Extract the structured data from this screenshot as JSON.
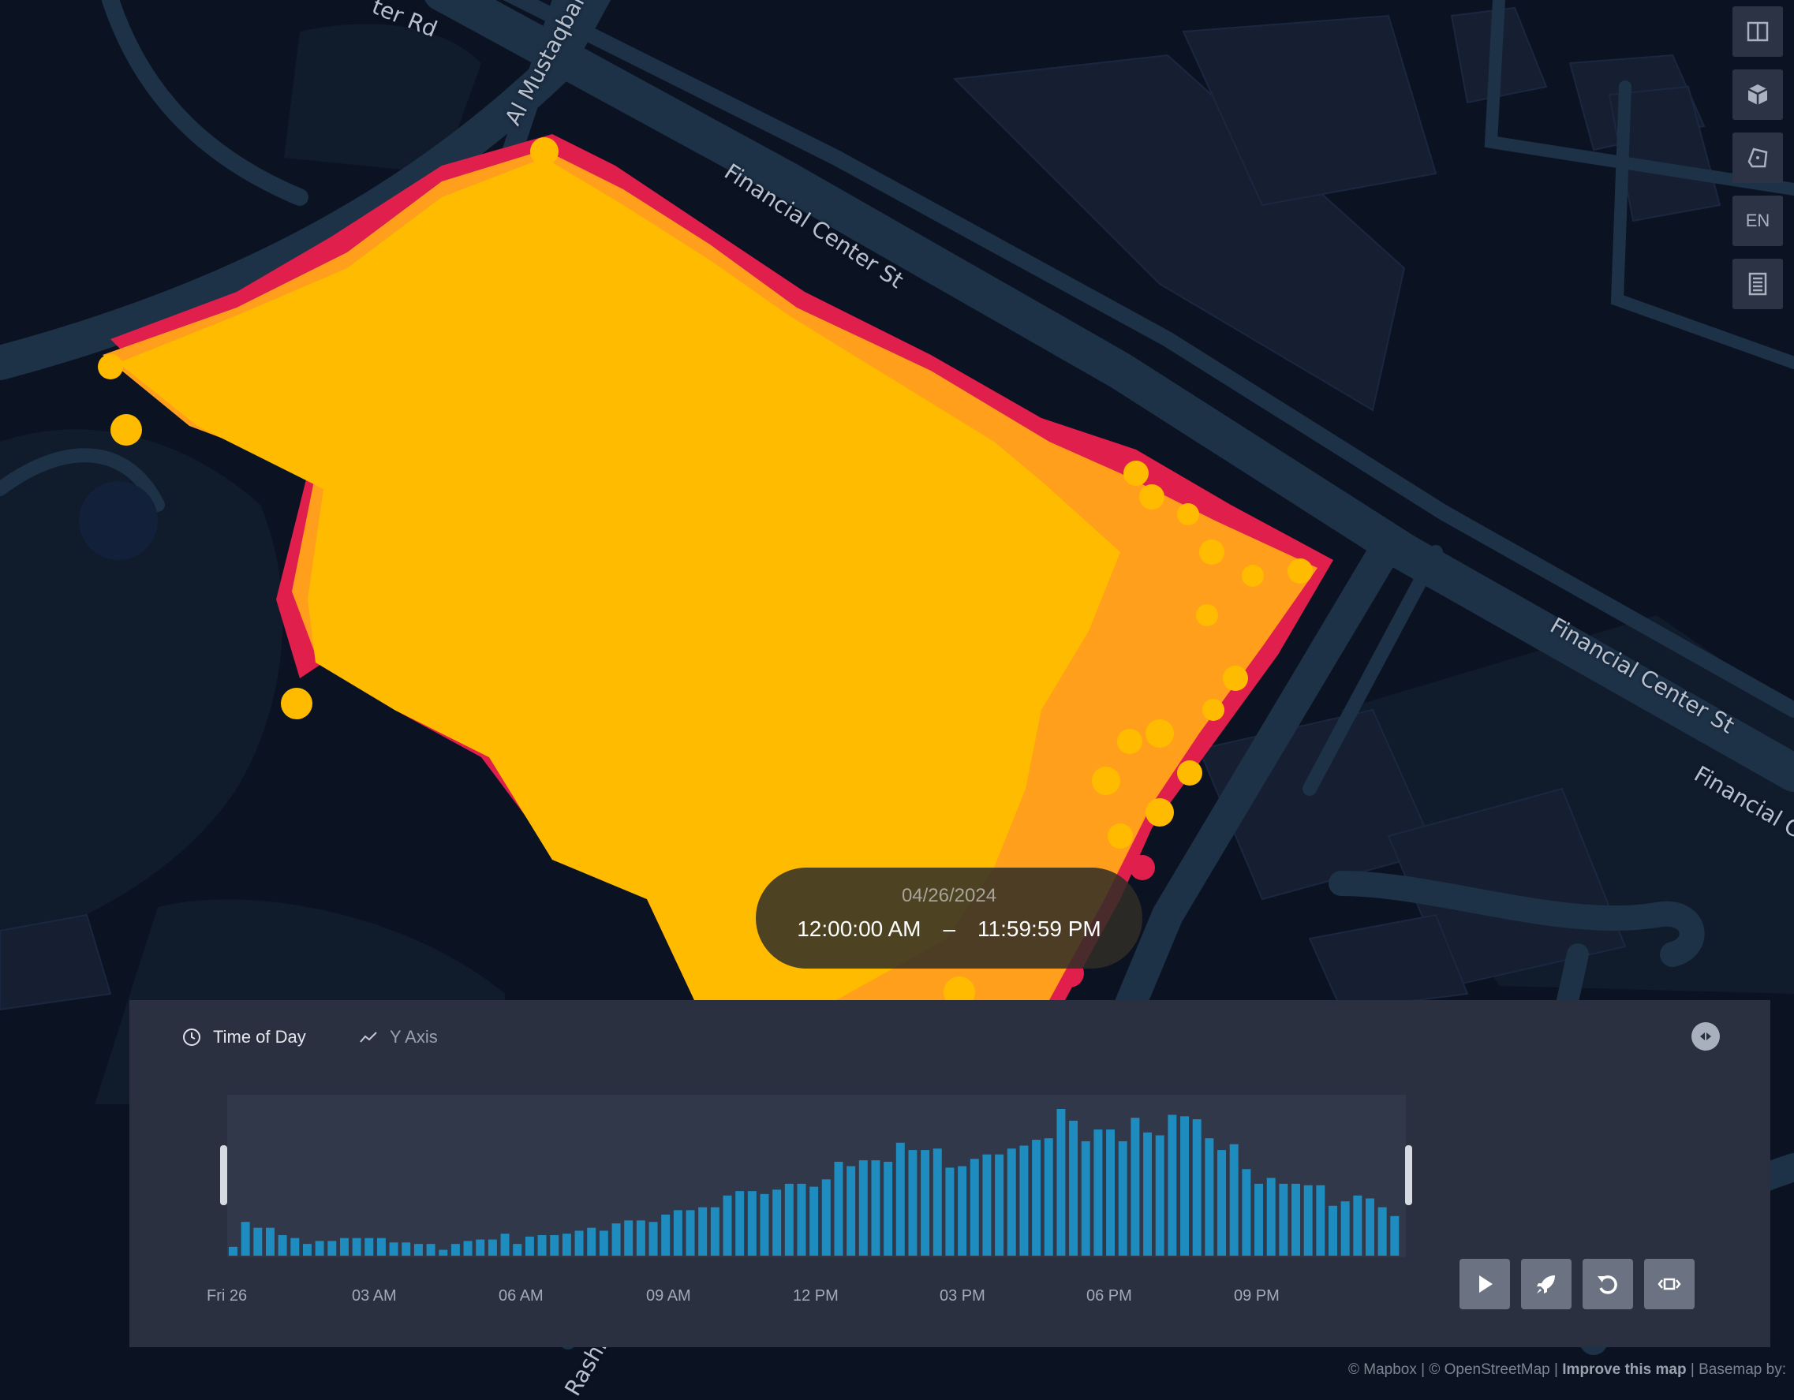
{
  "map": {
    "street_labels": [
      "ter Rd",
      "Al Mustaqbal",
      "Financial Center St",
      "Financial Center St",
      "Financial C",
      "Rashid"
    ],
    "colors": {
      "water": "#0b1222",
      "roads": "#1d3147",
      "points_main": "#ffbb00",
      "points_mid": "#ff9a1a",
      "points_edge": "#e8254a"
    }
  },
  "toolbar": {
    "buttons": [
      {
        "name": "split-map-icon"
      },
      {
        "name": "3d-cube-icon"
      },
      {
        "name": "draw-polygon-icon"
      },
      {
        "name": "language",
        "label": "EN"
      },
      {
        "name": "legend-icon"
      }
    ]
  },
  "time_bubble": {
    "date": "04/26/2024",
    "start": "12:00:00 AM",
    "separator": "–",
    "end": "11:59:59 PM"
  },
  "timeline": {
    "tabs": [
      {
        "name": "time-of-day",
        "label": "Time of Day",
        "icon": "clock-icon",
        "active": true
      },
      {
        "name": "y-axis",
        "label": "Y Axis",
        "icon": "line-chart-icon",
        "active": false
      }
    ],
    "controls": [
      "play-icon",
      "speed-rocket-icon",
      "reset-icon",
      "window-width-icon"
    ],
    "bar_color": "#1f8cbf"
  },
  "chart_data": {
    "type": "bar",
    "x_tick_labels": [
      "Fri 26",
      "03 AM",
      "06 AM",
      "09 AM",
      "12 PM",
      "03 PM",
      "06 PM",
      "09 PM"
    ],
    "values": [
      0.06,
      0.23,
      0.19,
      0.19,
      0.14,
      0.12,
      0.08,
      0.1,
      0.1,
      0.12,
      0.12,
      0.12,
      0.12,
      0.09,
      0.09,
      0.08,
      0.08,
      0.04,
      0.08,
      0.1,
      0.11,
      0.11,
      0.15,
      0.08,
      0.13,
      0.14,
      0.14,
      0.15,
      0.17,
      0.19,
      0.17,
      0.22,
      0.24,
      0.24,
      0.23,
      0.28,
      0.31,
      0.31,
      0.33,
      0.33,
      0.41,
      0.44,
      0.44,
      0.42,
      0.45,
      0.49,
      0.49,
      0.47,
      0.52,
      0.64,
      0.61,
      0.65,
      0.65,
      0.64,
      0.77,
      0.72,
      0.72,
      0.73,
      0.6,
      0.61,
      0.66,
      0.69,
      0.69,
      0.73,
      0.75,
      0.79,
      0.8,
      1.0,
      0.92,
      0.78,
      0.86,
      0.86,
      0.78,
      0.94,
      0.84,
      0.82,
      0.96,
      0.95,
      0.93,
      0.8,
      0.72,
      0.76,
      0.59,
      0.49,
      0.53,
      0.49,
      0.49,
      0.48,
      0.48,
      0.34,
      0.37,
      0.41,
      0.39,
      0.33,
      0.27
    ],
    "ylim": [
      0,
      1
    ]
  },
  "attribution": {
    "mapbox": "© Mapbox",
    "sep1": "|",
    "osm": "© OpenStreetMap",
    "sep2": "|",
    "improve": "Improve this map",
    "sep3": "|",
    "basemap": "Basemap by:"
  }
}
